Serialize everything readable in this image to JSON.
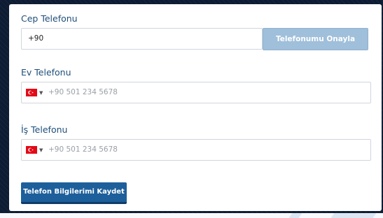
{
  "form": {
    "mobile": {
      "label": "Cep Telefonu",
      "value": "+90",
      "verify_button": "Telefonumu Onayla"
    },
    "home": {
      "label": "Ev Telefonu",
      "placeholder": "+90 501 234 5678",
      "country_flag": "turkey-flag-icon"
    },
    "work": {
      "label": "İş Telefonu",
      "placeholder": "+90 501 234 5678",
      "country_flag": "turkey-flag-icon"
    },
    "save_button": "Telefon Bilgilerimi Kaydet"
  },
  "colors": {
    "label": "#1e4e7a",
    "primary_button": "#1d5f9b",
    "disabled_button": "#9fbfda",
    "flag_red": "#e30a17",
    "backdrop": "#0d1c33"
  }
}
